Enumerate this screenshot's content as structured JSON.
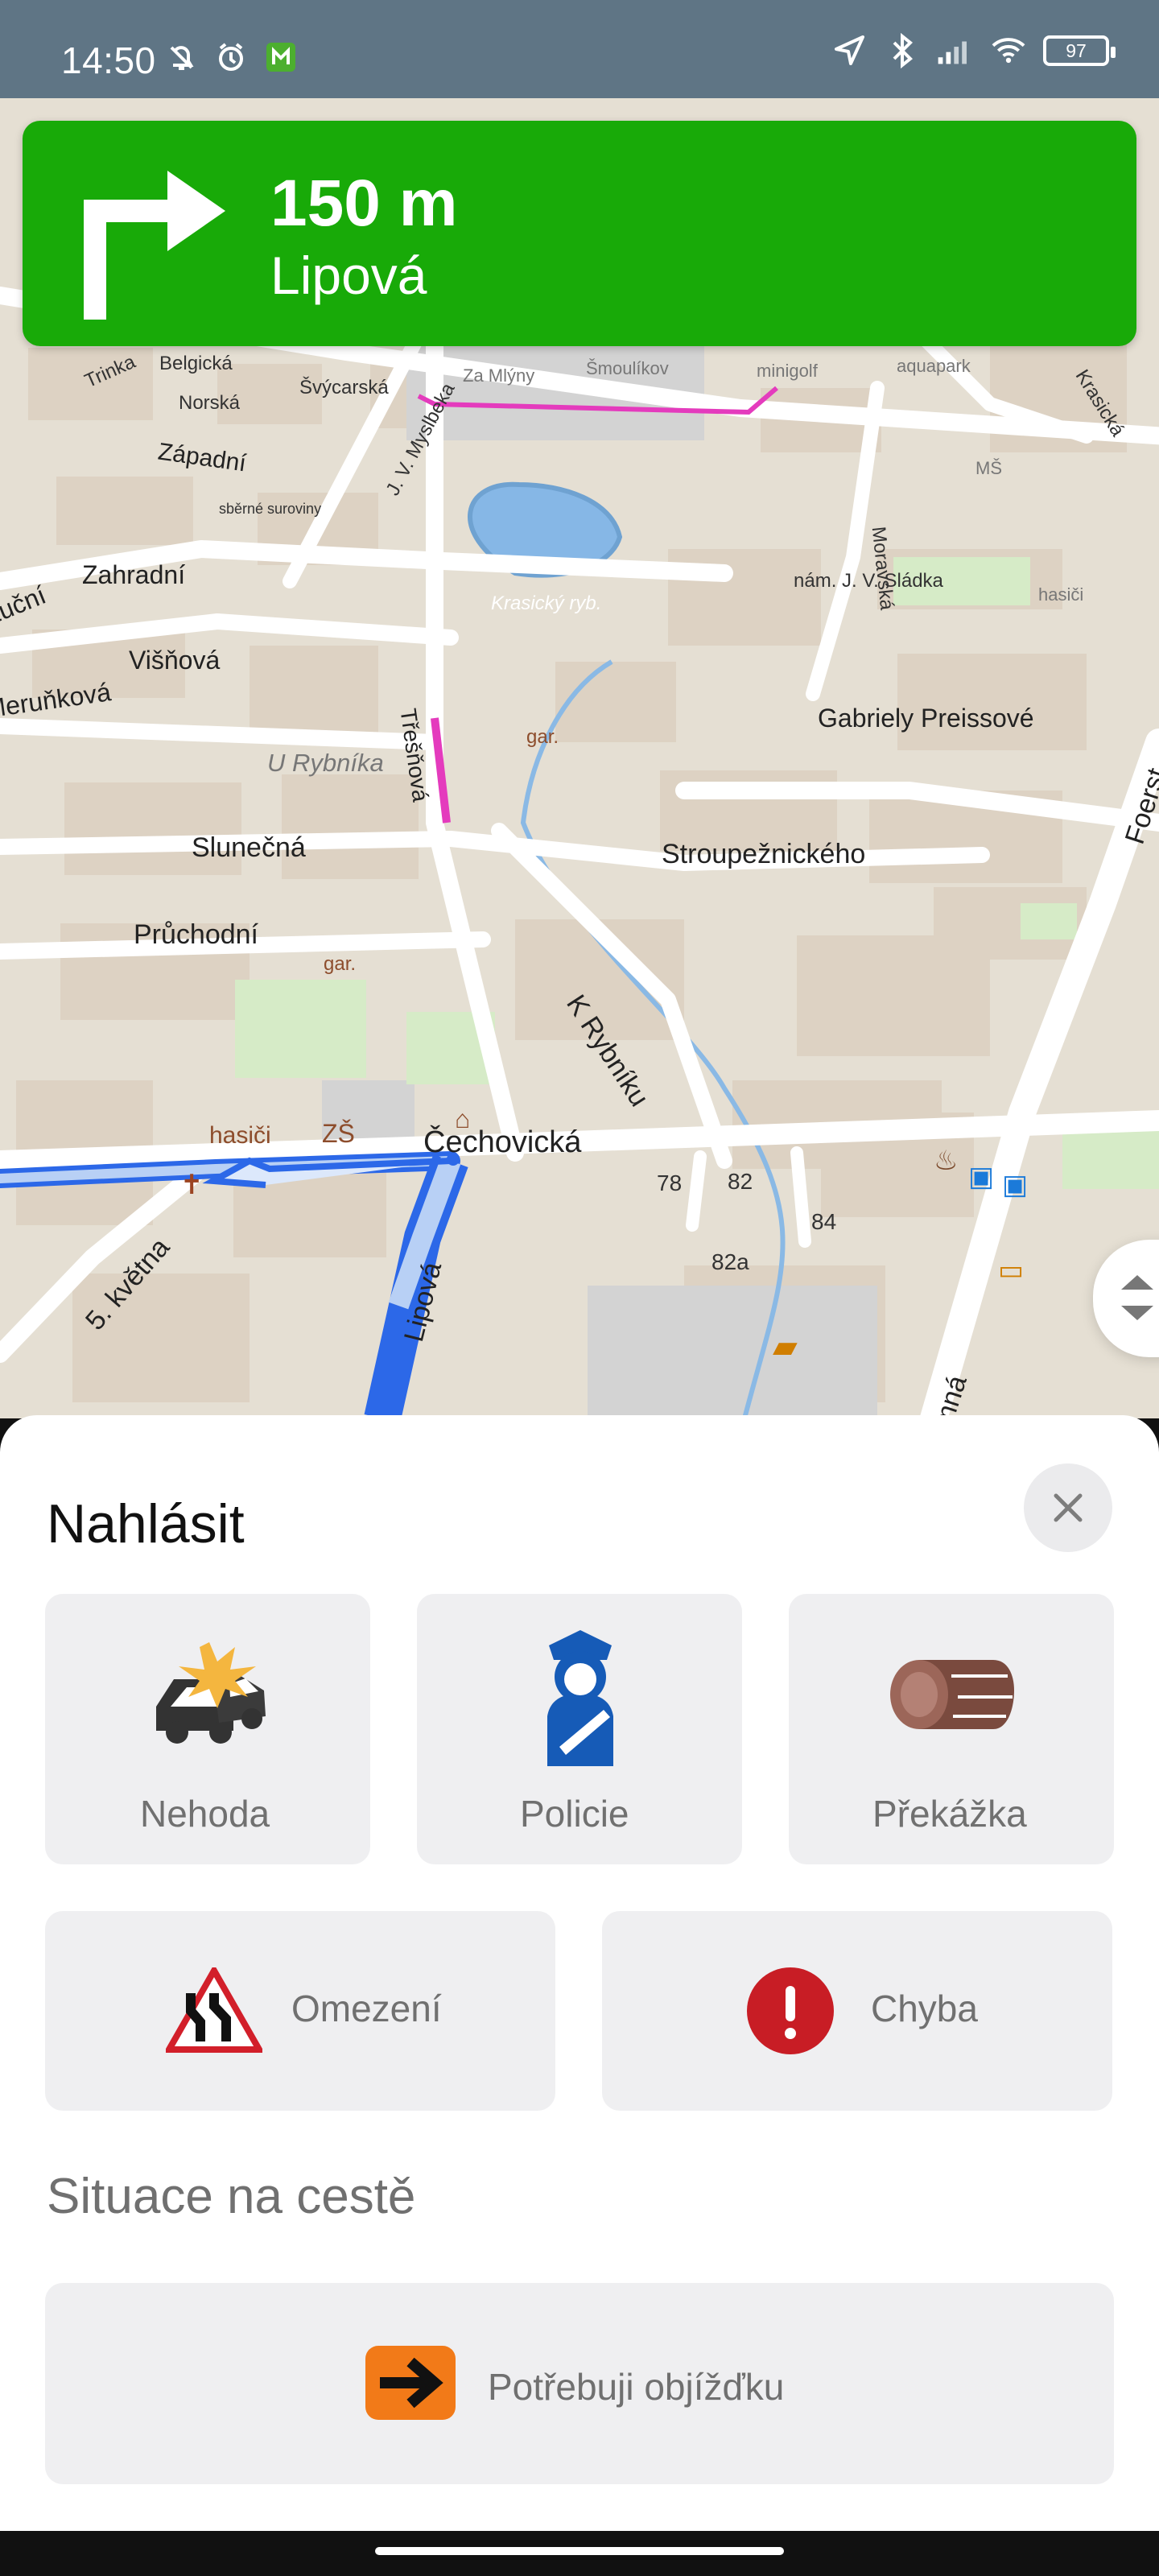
{
  "status": {
    "time": "14:50",
    "battery": "97"
  },
  "navigation": {
    "distance": "150 m",
    "street": "Lipová",
    "accent": "#18aa08"
  },
  "map": {
    "labels": [
      {
        "text": "Belgická"
      },
      {
        "text": "Trinka"
      },
      {
        "text": "Švýcarská"
      },
      {
        "text": "Za Mlýny"
      },
      {
        "text": "Šmoulíkov"
      },
      {
        "text": "minigolf"
      },
      {
        "text": "aquapark"
      },
      {
        "text": "Norská"
      },
      {
        "text": "J. V. Myslbeka"
      },
      {
        "text": "Krasická"
      },
      {
        "text": "Západní"
      },
      {
        "text": "sběrné suroviny"
      },
      {
        "text": "Moravská"
      },
      {
        "text": "MŠ"
      },
      {
        "text": "Zahradní"
      },
      {
        "text": "Luční"
      },
      {
        "text": "Krasický ryb."
      },
      {
        "text": "nám. J. V. Sládka"
      },
      {
        "text": "hasiči"
      },
      {
        "text": "Višňová"
      },
      {
        "text": "Meruňková"
      },
      {
        "text": "U Rybníka"
      },
      {
        "text": "Gabriely Preissové"
      },
      {
        "text": "Třešňová"
      },
      {
        "text": "Slunečná"
      },
      {
        "text": "Stroupežnického"
      },
      {
        "text": "Průchodní"
      },
      {
        "text": "K Rybníku"
      },
      {
        "text": "Čechovická"
      },
      {
        "text": "5. května"
      },
      {
        "text": "ZŠ"
      },
      {
        "text": "hasiči"
      },
      {
        "text": "gar."
      },
      {
        "text": "gar."
      },
      {
        "text": "Foerst"
      },
      {
        "text": "Lipová"
      },
      {
        "text": "mná"
      },
      {
        "text": "82a"
      },
      {
        "text": "84"
      },
      {
        "text": "82"
      },
      {
        "text": "78"
      }
    ]
  },
  "report": {
    "title": "Nahlásit",
    "items": [
      {
        "label": "Nehoda",
        "icon": "car-crash-icon"
      },
      {
        "label": "Policie",
        "icon": "police-officer-icon"
      },
      {
        "label": "Překážka",
        "icon": "log-obstacle-icon"
      },
      {
        "label": "Omezení",
        "icon": "road-narrowing-icon"
      },
      {
        "label": "Chyba",
        "icon": "error-icon"
      }
    ],
    "section_title": "Situace na cestě",
    "detour_label": "Potřebuji objížďku"
  }
}
